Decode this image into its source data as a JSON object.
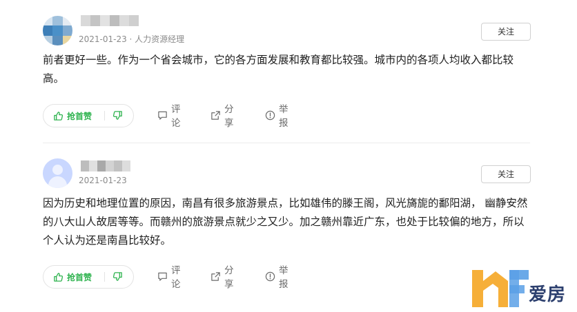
{
  "answers": [
    {
      "meta": "2021-01-23 · 人力资源经理",
      "follow_label": "关注",
      "content": "前者更好一些。作为一个省会城市，它的各方面发展和教育都比较强。城市内的各项人均收入都比较高。",
      "actions": {
        "like_label": "抢首赞",
        "comment_label": "评论",
        "share_label": "分享",
        "report_label": "举报"
      }
    },
    {
      "meta": "2021-01-23",
      "follow_label": "关注",
      "content": "因为历史和地理位置的原因，南昌有很多旅游景点，比如雄伟的滕王阁，风光旖旎的鄱阳湖， 幽静安然的八大山人故居等等。而赣州的旅游景点就少之又少。加之赣州靠近广东，也处于比较偏的地方，所以个人认为还是南昌比较好。",
      "actions": {
        "like_label": "抢首赞",
        "comment_label": "评论",
        "share_label": "分享",
        "report_label": "举报"
      }
    }
  ],
  "watermark": {
    "text": "爱房"
  },
  "colors": {
    "like_green": "#2fb34f",
    "text": "#1f1f1f",
    "meta": "#8a8a8a",
    "brand_orange": "#f5a623",
    "brand_blue": "#5aa0e6"
  },
  "icons": [
    "like-icon",
    "dislike-icon",
    "comment-icon",
    "share-icon",
    "report-icon",
    "brand-logo-icon"
  ]
}
